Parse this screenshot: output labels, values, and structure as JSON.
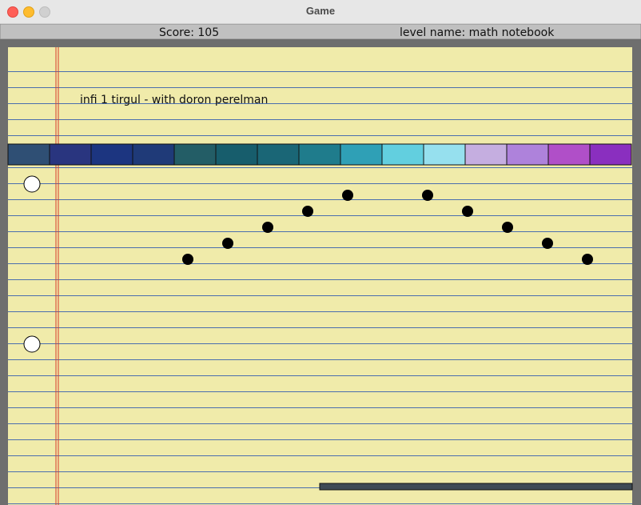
{
  "window": {
    "title": "Game"
  },
  "hud": {
    "score_text": "Score: 105",
    "level_text": "level name: math notebook"
  },
  "level": {
    "caption": "infi 1 tirgul - with doron perelman",
    "colors": {
      "paper": "#f0ebaa",
      "ruled_line": "#4a6eae",
      "margin_line": "#d9382b",
      "border": "#6e6e6e",
      "hud_bar": "#c0c0c0",
      "paddle": "#3e4a55"
    },
    "block_colors": [
      "#2f4f74",
      "#29357f",
      "#1c3580",
      "#1f3a78",
      "#235d66",
      "#175d6c",
      "#1a6676",
      "#1f7c8c",
      "#2fa0b6",
      "#62cfdf",
      "#96e0ee",
      "#c5aee0",
      "#ae82db",
      "#b04fc8",
      "#8a2fbf"
    ],
    "balls": [
      "ball",
      "ball"
    ],
    "targets": [
      "target",
      "target",
      "target",
      "target",
      "target",
      "target",
      "target",
      "target",
      "target",
      "target"
    ]
  }
}
